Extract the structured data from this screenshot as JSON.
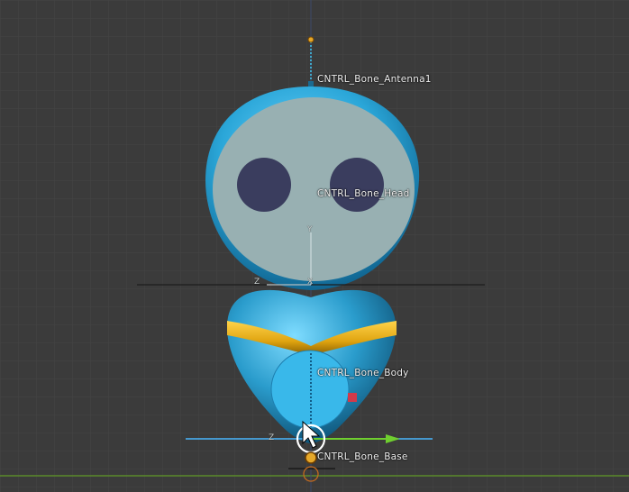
{
  "viewport": {
    "bones": {
      "antenna": "CNTRL_Bone_Antenna1",
      "head": "CNTRL_Bone_Head",
      "body": "CNTRL_Bone_Body",
      "base": "CNTRL_Bone_Base"
    },
    "axes": {
      "y_label": "Y",
      "z_label": "Z",
      "x_label": "X"
    },
    "colors": {
      "background": "#3b3b3b",
      "grid": "#474747",
      "character_blue": "#2aa6d8",
      "face": "#98b0b2",
      "eyes": "#3a3d5e",
      "belt": "#e0a410",
      "body_control": "#39b8ea",
      "manipulator_green": "#6fcf2f",
      "ground_line": "#5a8a2a"
    }
  }
}
